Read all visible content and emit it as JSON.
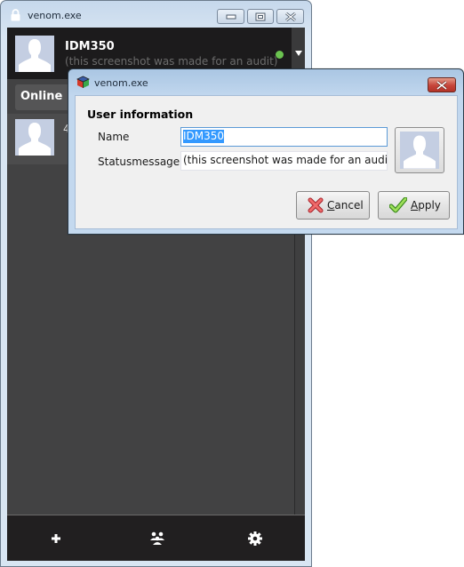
{
  "main_window": {
    "title": "venom.exe",
    "profile": {
      "name": "IDM350",
      "status_message": "(this screenshot was made for an audit)",
      "status_color": "#6bc350"
    },
    "status_filter": {
      "selected": "Online"
    },
    "friends": [
      {
        "name": "4"
      }
    ],
    "bottom_bar": {
      "add_label": "add-friend",
      "groups_label": "groups",
      "settings_label": "settings"
    }
  },
  "dialog": {
    "title": "venom.exe",
    "group_title": "User information",
    "name_label": "Name",
    "name_value": "IDM350",
    "status_label": "Statusmessage",
    "status_value": "(this screenshot was made for an audit)",
    "cancel_label_mnemonic": "C",
    "cancel_label_rest": "ancel",
    "apply_label_mnemonic": "A",
    "apply_label_rest": "pply"
  }
}
